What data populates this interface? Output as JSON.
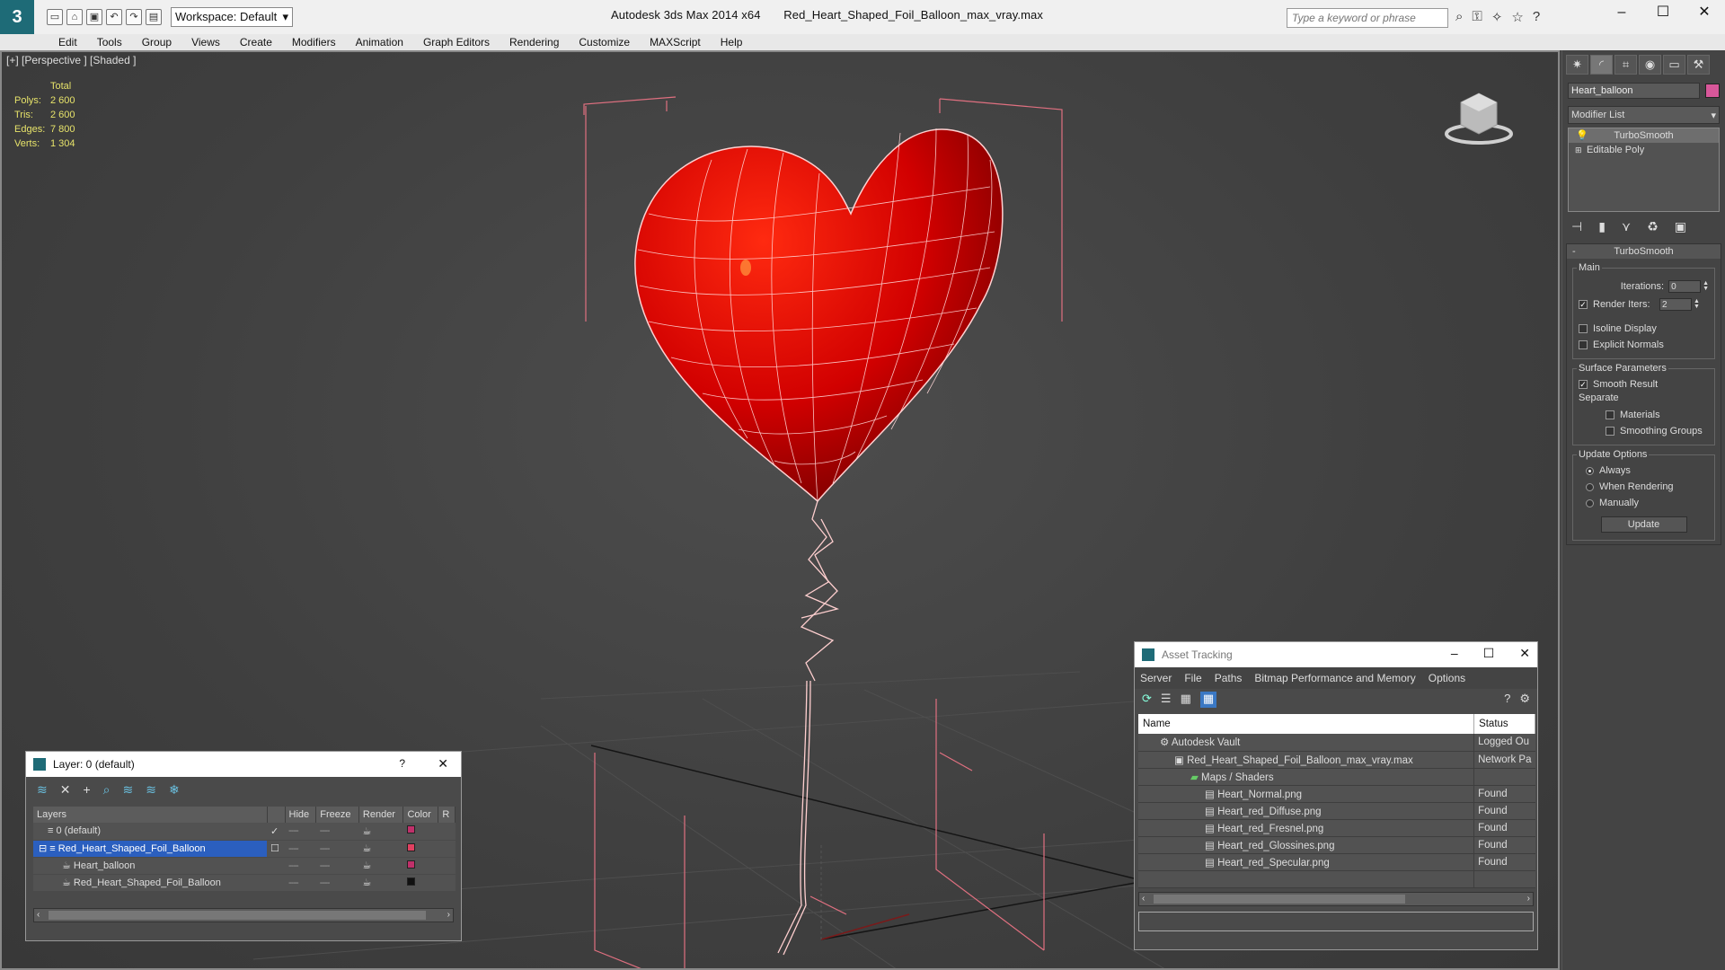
{
  "app": {
    "title": "Autodesk 3ds Max  2014 x64",
    "filename": "Red_Heart_Shaped_Foil_Balloon_max_vray.max",
    "workspace": "Workspace: Default",
    "search_placeholder": "Type a keyword or phrase"
  },
  "menu": [
    "Edit",
    "Tools",
    "Group",
    "Views",
    "Create",
    "Modifiers",
    "Animation",
    "Graph Editors",
    "Rendering",
    "Customize",
    "MAXScript",
    "Help"
  ],
  "viewport": {
    "label": "[+] [Perspective ] [Shaded ]",
    "stats": {
      "header": "Total",
      "rows": [
        {
          "k": "Polys:",
          "v": "2 600"
        },
        {
          "k": "Tris:",
          "v": "2 600"
        },
        {
          "k": "Edges:",
          "v": "7 800"
        },
        {
          "k": "Verts:",
          "v": "1 304"
        }
      ]
    }
  },
  "command_panel": {
    "object_name": "Heart_balloon",
    "object_color": "#d8579a",
    "modifier_list": "Modifier List",
    "stack": [
      "TurboSmooth",
      "Editable Poly"
    ],
    "turbosmooth": {
      "title": "TurboSmooth",
      "main": "Main",
      "iterations_label": "Iterations:",
      "iterations": "0",
      "render_iters_label": "Render Iters:",
      "render_iters": "2",
      "isoline": "Isoline Display",
      "explicit_normals": "Explicit Normals",
      "surface_params": "Surface Parameters",
      "smooth_result": "Smooth Result",
      "separate": "Separate",
      "materials": "Materials",
      "smoothing_groups": "Smoothing Groups",
      "update_options": "Update Options",
      "always": "Always",
      "when_rendering": "When Rendering",
      "manually": "Manually",
      "update_btn": "Update"
    }
  },
  "layer_dialog": {
    "title": "Layer: 0 (default)",
    "help": "?",
    "columns": [
      "Layers",
      "",
      "Hide",
      "Freeze",
      "Render",
      "Color",
      "R"
    ],
    "rows": [
      {
        "name": "0 (default)",
        "color": "#c0306a"
      },
      {
        "name": "Red_Heart_Shaped_Foil_Balloon",
        "color": "#e04060"
      },
      {
        "name": "Heart_balloon",
        "color": "#c0306a"
      },
      {
        "name": "Red_Heart_Shaped_Foil_Balloon",
        "color": "#111111"
      }
    ]
  },
  "asset_dialog": {
    "title": "Asset Tracking",
    "menu": [
      "Server",
      "File",
      "Paths",
      "Bitmap Performance and Memory",
      "Options"
    ],
    "columns": [
      "Name",
      "Status"
    ],
    "rows": [
      {
        "name": "Autodesk Vault",
        "status": "Logged Ou"
      },
      {
        "name": "Red_Heart_Shaped_Foil_Balloon_max_vray.max",
        "status": "Network Pa"
      },
      {
        "name": "Maps / Shaders",
        "status": ""
      },
      {
        "name": "Heart_Normal.png",
        "status": "Found"
      },
      {
        "name": "Heart_red_Diffuse.png",
        "status": "Found"
      },
      {
        "name": "Heart_red_Fresnel.png",
        "status": "Found"
      },
      {
        "name": "Heart_red_Glossines.png",
        "status": "Found"
      },
      {
        "name": "Heart_red_Specular.png",
        "status": "Found"
      }
    ]
  }
}
